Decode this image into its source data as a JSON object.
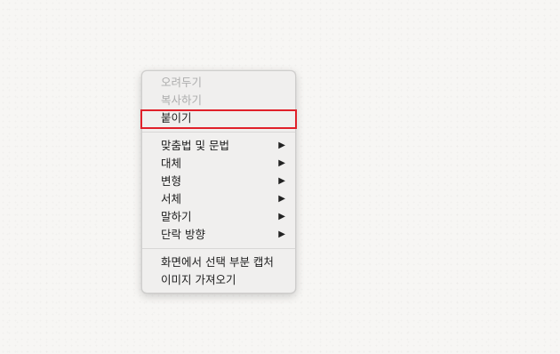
{
  "context_menu": {
    "items": [
      {
        "label": "오려두기",
        "enabled": false
      },
      {
        "label": "복사하기",
        "enabled": false
      },
      {
        "label": "붙이기",
        "enabled": true,
        "highlighted": true,
        "highlight_color": "#e0202a"
      },
      {
        "label": "맞춤법 및 문법",
        "submenu": true
      },
      {
        "label": "대체",
        "submenu": true
      },
      {
        "label": "변형",
        "submenu": true
      },
      {
        "label": "서체",
        "submenu": true
      },
      {
        "label": "말하기",
        "submenu": true
      },
      {
        "label": "단락 방향",
        "submenu": true
      },
      {
        "label": "화면에서 선택 부분 캡처"
      },
      {
        "label": "이미지 가져오기"
      }
    ],
    "submenu_arrow": "▶"
  }
}
